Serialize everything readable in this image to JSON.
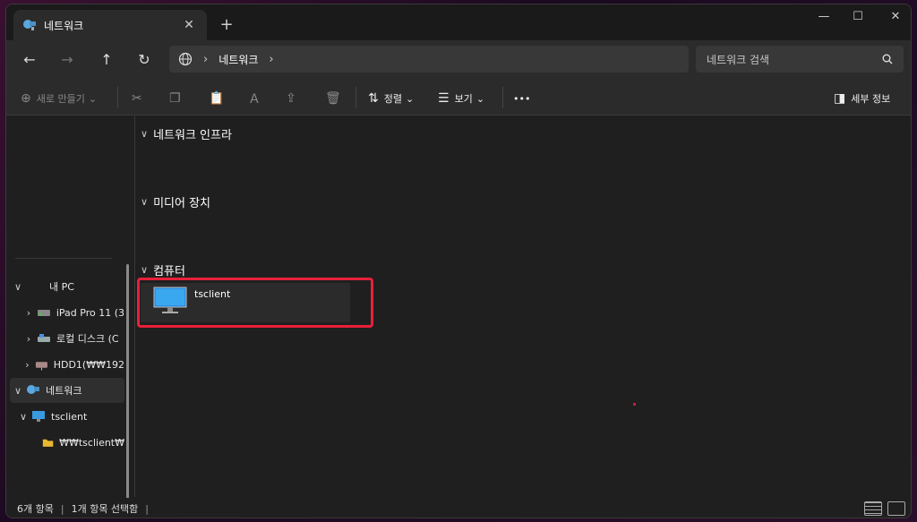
{
  "tab": {
    "title": "네트워크",
    "close": "✕",
    "new": "+"
  },
  "window_controls": {
    "minimize": "—",
    "maximize": "☐",
    "close": "✕"
  },
  "nav": {
    "back": "←",
    "forward": "→",
    "up": "↑",
    "refresh": "↻",
    "breadcrumb": [
      "네트워크"
    ],
    "chevron": "›",
    "search_placeholder": "네트워크 검색"
  },
  "toolbar": {
    "new_label": "새로 만들기",
    "sort_label": "정렬",
    "view_label": "보기",
    "more": "•••",
    "details_label": "세부 정보"
  },
  "sidebar": {
    "items": [
      {
        "label": "내 PC",
        "arrow": "∨",
        "icon": "pc-icon"
      },
      {
        "label": "iPad Pro 11 (3",
        "arrow": "›",
        "icon": "drive-icon"
      },
      {
        "label": "로컬 디스크 (C",
        "arrow": "›",
        "icon": "disk-icon"
      },
      {
        "label": "HDD1(₩₩192",
        "arrow": "›",
        "icon": "network-drive-icon"
      },
      {
        "label": "네트워크",
        "arrow": "∨",
        "icon": "network-icon"
      },
      {
        "label": "tsclient",
        "arrow": "∨",
        "icon": "monitor-icon"
      },
      {
        "label": "₩₩tsclient₩",
        "arrow": "",
        "icon": "folder-icon"
      }
    ]
  },
  "groups": [
    {
      "label": "네트워크 인프라",
      "arrow": "∨"
    },
    {
      "label": "미디어 장치",
      "arrow": "∨"
    },
    {
      "label": "컴퓨터",
      "arrow": "∨"
    }
  ],
  "computer_item": {
    "name": "tsclient"
  },
  "status": {
    "count": "6개 항목",
    "selected": "1개 항목 선택함",
    "bar": "|"
  },
  "colors": {
    "accent": "#e8203a",
    "bg": "#1f1f1f",
    "panel": "#2b2b2b"
  }
}
